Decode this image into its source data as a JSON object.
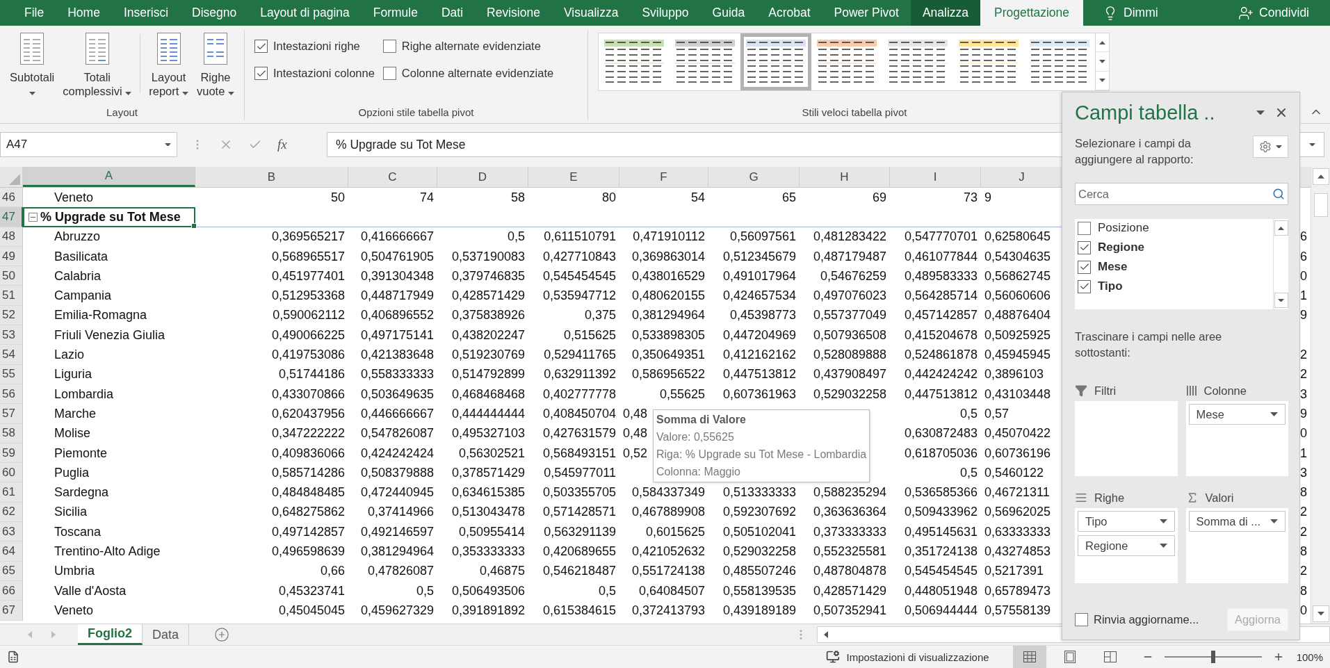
{
  "ribbon_tabs": [
    {
      "label": "File",
      "selected": false,
      "contextual": false
    },
    {
      "label": "Home",
      "selected": false,
      "contextual": false
    },
    {
      "label": "Inserisci",
      "selected": false,
      "contextual": false
    },
    {
      "label": "Disegno",
      "selected": false,
      "contextual": false
    },
    {
      "label": "Layout di pagina",
      "selected": false,
      "contextual": false
    },
    {
      "label": "Formule",
      "selected": false,
      "contextual": false
    },
    {
      "label": "Dati",
      "selected": false,
      "contextual": false
    },
    {
      "label": "Revisione",
      "selected": false,
      "contextual": false
    },
    {
      "label": "Visualizza",
      "selected": false,
      "contextual": false
    },
    {
      "label": "Sviluppo",
      "selected": false,
      "contextual": false
    },
    {
      "label": "Guida",
      "selected": false,
      "contextual": false
    },
    {
      "label": "Acrobat",
      "selected": false,
      "contextual": false
    },
    {
      "label": "Power Pivot",
      "selected": false,
      "contextual": false
    },
    {
      "label": "Analizza",
      "selected": false,
      "contextual": true
    },
    {
      "label": "Progettazione",
      "selected": true,
      "contextual": true
    }
  ],
  "ribbon_extras": [
    {
      "kind": "tell-me",
      "label": "Dimmi"
    },
    {
      "kind": "share",
      "label": "Condividi"
    }
  ],
  "layout_group": {
    "label": "Layout",
    "buttons": [
      {
        "kind": "subtotals",
        "lines": [
          "Subtotali"
        ],
        "dropdown": true
      },
      {
        "kind": "grand-totals",
        "lines": [
          "Totali",
          "complessivi"
        ],
        "dropdown": true
      },
      {
        "kind": "report-layout",
        "lines": [
          "Layout",
          "report"
        ],
        "dropdown": true
      },
      {
        "kind": "blank-rows",
        "lines": [
          "Righe",
          "vuote"
        ],
        "dropdown": true
      }
    ]
  },
  "style_options": {
    "label": "Opzioni stile tabella pivot",
    "options": [
      {
        "label": "Intestazioni righe",
        "checked": true
      },
      {
        "label": "Righe alternate evidenziate",
        "checked": false
      },
      {
        "label": "Intestazioni colonne",
        "checked": true
      },
      {
        "label": "Colonne alternate evidenziate",
        "checked": false
      }
    ]
  },
  "quick_styles": {
    "label": "Stili veloci tabella pivot",
    "styles": [
      {
        "color": "#c6e0b4",
        "selected": false
      },
      {
        "color": "#d0d0d0",
        "selected": false
      },
      {
        "color": "#d9e1f2",
        "selected": true
      },
      {
        "color": "#f8cbad",
        "selected": false
      },
      {
        "color": "#e7e6e6",
        "selected": false
      },
      {
        "color": "#ffe699",
        "selected": false
      },
      {
        "color": "#ddebf7",
        "selected": false
      }
    ]
  },
  "formula_bar": {
    "name_box": "A47",
    "function_label": "fx",
    "formula": "% Upgrade su Tot Mese"
  },
  "sheet": {
    "columns": [
      {
        "label": "A",
        "selected": true
      },
      {
        "label": "B",
        "selected": false
      },
      {
        "label": "C",
        "selected": false
      },
      {
        "label": "D",
        "selected": false
      },
      {
        "label": "E",
        "selected": false
      },
      {
        "label": "F",
        "selected": false
      },
      {
        "label": "G",
        "selected": false
      },
      {
        "label": "H",
        "selected": false
      },
      {
        "label": "I",
        "selected": false
      },
      {
        "label": "J",
        "selected": false,
        "clipped": true
      }
    ],
    "rows": [
      {
        "number": "46",
        "kind": "item",
        "selected": false,
        "label": "Veneto",
        "cells": [
          "50",
          "74",
          "58",
          "80",
          "54",
          "65",
          "69",
          "73",
          "9"
        ]
      },
      {
        "number": "47",
        "kind": "group",
        "selected": true,
        "expanded": true,
        "label": "% Upgrade su Tot Mese"
      },
      {
        "number": "48",
        "kind": "item",
        "selected": false,
        "label": "Abruzzo",
        "cells": [
          "0,369565217",
          "0,416666667",
          "0,5",
          "0,611510791",
          "0,471910112",
          "0,56097561",
          "0,481283422",
          "0,547770701",
          "0,62580645"
        ],
        "edge": "6"
      },
      {
        "number": "49",
        "kind": "item",
        "selected": false,
        "label": "Basilicata",
        "cells": [
          "0,568965517",
          "0,504761905",
          "0,537190083",
          "0,427710843",
          "0,369863014",
          "0,512345679",
          "0,487179487",
          "0,461077844",
          "0,54304635"
        ],
        "edge": "6"
      },
      {
        "number": "50",
        "kind": "item",
        "selected": false,
        "label": "Calabria",
        "cells": [
          "0,451977401",
          "0,391304348",
          "0,379746835",
          "0,545454545",
          "0,438016529",
          "0,491017964",
          "0,54676259",
          "0,489583333",
          "0,56862745"
        ],
        "edge": "0"
      },
      {
        "number": "51",
        "kind": "item",
        "selected": false,
        "label": "Campania",
        "cells": [
          "0,512953368",
          "0,448717949",
          "0,428571429",
          "0,535947712",
          "0,480620155",
          "0,424657534",
          "0,497076023",
          "0,564285714",
          "0,56060606"
        ],
        "edge": "1"
      },
      {
        "number": "52",
        "kind": "item",
        "selected": false,
        "label": "Emilia-Romagna",
        "cells": [
          "0,590062112",
          "0,406896552",
          "0,375838926",
          "0,375",
          "0,381294964",
          "0,45398773",
          "0,557377049",
          "0,457142857",
          "0,48876404"
        ],
        "edge": "9"
      },
      {
        "number": "53",
        "kind": "item",
        "selected": false,
        "label": "Friuli Venezia Giulia",
        "cells": [
          "0,490066225",
          "0,497175141",
          "0,438202247",
          "0,515625",
          "0,533898305",
          "0,447204969",
          "0,507936508",
          "0,415204678",
          "0,50925925"
        ]
      },
      {
        "number": "54",
        "kind": "item",
        "selected": false,
        "label": "Lazio",
        "cells": [
          "0,419753086",
          "0,421383648",
          "0,519230769",
          "0,529411765",
          "0,350649351",
          "0,412162162",
          "0,528089888",
          "0,524861878",
          "0,45945945"
        ],
        "edge": "2"
      },
      {
        "number": "55",
        "kind": "item",
        "selected": false,
        "label": "Liguria",
        "cells": [
          "0,51744186",
          "0,558333333",
          "0,514792899",
          "0,632911392",
          "0,586956522",
          "0,447513812",
          "0,437908497",
          "0,442424242",
          "0,3896103"
        ],
        "edge": "2"
      },
      {
        "number": "56",
        "kind": "item",
        "selected": false,
        "label": "Lombardia",
        "cells": [
          "0,433070866",
          "0,503649635",
          "0,468468468",
          "0,402777778",
          "0,55625",
          "0,607361963",
          "0,529032258",
          "0,447513812",
          "0,43103448"
        ],
        "edge": "3"
      },
      {
        "number": "57",
        "kind": "item",
        "selected": false,
        "label": "Marche",
        "cells": [
          "0,620437956",
          "0,446666667",
          "0,444444444",
          "0,408450704",
          {
            "text": "0,48",
            "clipped": true
          },
          null,
          null,
          "0,5",
          "0,57"
        ],
        "edge": "9"
      },
      {
        "number": "58",
        "kind": "item",
        "selected": false,
        "label": "Molise",
        "cells": [
          "0,347222222",
          "0,547826087",
          "0,495327103",
          "0,427631579",
          {
            "text": "0,48",
            "clipped": true
          },
          null,
          null,
          "0,630872483",
          "0,45070422"
        ],
        "edge": "0"
      },
      {
        "number": "59",
        "kind": "item",
        "selected": false,
        "label": "Piemonte",
        "cells": [
          "0,409836066",
          "0,424242424",
          "0,56302521",
          "0,568493151",
          {
            "text": "0,52",
            "clipped": true
          },
          null,
          null,
          "0,618705036",
          "0,60736196"
        ],
        "edge": "1"
      },
      {
        "number": "60",
        "kind": "item",
        "selected": false,
        "label": "Puglia",
        "cells": [
          "0,585714286",
          "0,508379888",
          "0,378571429",
          "0,545977011",
          null,
          null,
          null,
          "0,5",
          "0,5460122"
        ],
        "edge": "3"
      },
      {
        "number": "61",
        "kind": "item",
        "selected": false,
        "label": "Sardegna",
        "cells": [
          "0,484848485",
          "0,472440945",
          "0,634615385",
          "0,503355705",
          "0,584337349",
          "0,513333333",
          "0,588235294",
          "0,536585366",
          "0,46721311"
        ],
        "edge": "8"
      },
      {
        "number": "62",
        "kind": "item",
        "selected": false,
        "label": "Sicilia",
        "cells": [
          "0,648275862",
          "0,37414966",
          "0,513043478",
          "0,571428571",
          "0,467889908",
          "0,592307692",
          "0,363636364",
          "0,509433962",
          "0,56962025"
        ],
        "edge": "2"
      },
      {
        "number": "63",
        "kind": "item",
        "selected": false,
        "label": "Toscana",
        "cells": [
          "0,497142857",
          "0,492146597",
          "0,50955414",
          "0,563291139",
          "0,6015625",
          "0,505102041",
          "0,373333333",
          "0,495145631",
          "0,63333333"
        ],
        "edge": "2"
      },
      {
        "number": "64",
        "kind": "item",
        "selected": false,
        "label": "Trentino-Alto Adige",
        "cells": [
          "0,496598639",
          "0,381294964",
          "0,353333333",
          "0,420689655",
          "0,421052632",
          "0,529032258",
          "0,552325581",
          "0,351724138",
          "0,43274853"
        ],
        "edge": "8"
      },
      {
        "number": "65",
        "kind": "item",
        "selected": false,
        "label": "Umbria",
        "cells": [
          "0,66",
          "0,47826087",
          "0,46875",
          "0,546218487",
          "0,551724138",
          "0,485507246",
          "0,487804878",
          "0,545454545",
          "0,5217391"
        ],
        "edge": "2"
      },
      {
        "number": "66",
        "kind": "item",
        "selected": false,
        "label": "Valle d'Aosta",
        "cells": [
          "0,45323741",
          "0,5",
          "0,506493506",
          "0,5",
          "0,64084507",
          "0,558139535",
          "0,428571429",
          "0,448051948",
          "0,65789473"
        ],
        "edge": "8"
      },
      {
        "number": "67",
        "kind": "item",
        "selected": false,
        "label": "Veneto",
        "cells": [
          "0,45045045",
          "0,459627329",
          "0,391891892",
          "0,615384615",
          "0,372413793",
          "0,439189189",
          "0,507352941",
          "0,506944444",
          "0,57558139"
        ],
        "edge": "0"
      }
    ]
  },
  "tooltip": {
    "title": "Somma di Valore",
    "lines": [
      "Valore: 0,55625",
      "Riga: % Upgrade su Tot Mese - Lombardia",
      "Colonna: Maggio"
    ]
  },
  "sheet_tabs": [
    {
      "label": "Foglio2",
      "selected": true
    },
    {
      "label": "Data",
      "selected": false
    }
  ],
  "status_bar": {
    "display_settings": "Impostazioni di visualizzazione",
    "views": [
      {
        "kind": "normal",
        "selected": true
      },
      {
        "kind": "page-layout",
        "selected": false
      },
      {
        "kind": "page-break",
        "selected": false
      }
    ],
    "zoom": {
      "level": 0.5,
      "label": "100%"
    }
  },
  "field_list": {
    "title": "Campi tabella ..",
    "instruction": "Selezionare i campi da aggiungere al rapporto:",
    "search_placeholder": "Cerca",
    "fields": [
      {
        "label": "Posizione",
        "checked": false
      },
      {
        "label": "Regione",
        "checked": true
      },
      {
        "label": "Mese",
        "checked": true
      },
      {
        "label": "Tipo",
        "checked": true
      }
    ],
    "drag_hint": "Trascinare i campi nelle aree sottostanti:",
    "areas": [
      {
        "kind": "filters",
        "label": "Filtri"
      },
      {
        "kind": "columns",
        "label": "Colonne",
        "items": [
          "Mese"
        ]
      },
      {
        "kind": "rows",
        "label": "Righe",
        "items": [
          "Tipo",
          "Regione"
        ]
      },
      {
        "kind": "values",
        "label": "Valori",
        "items": [
          "Somma di ..."
        ]
      }
    ],
    "defer": {
      "label": "Rinvia aggiorname...",
      "checked": false
    },
    "update_button": {
      "label": "Aggiorna",
      "disabled": true
    }
  }
}
